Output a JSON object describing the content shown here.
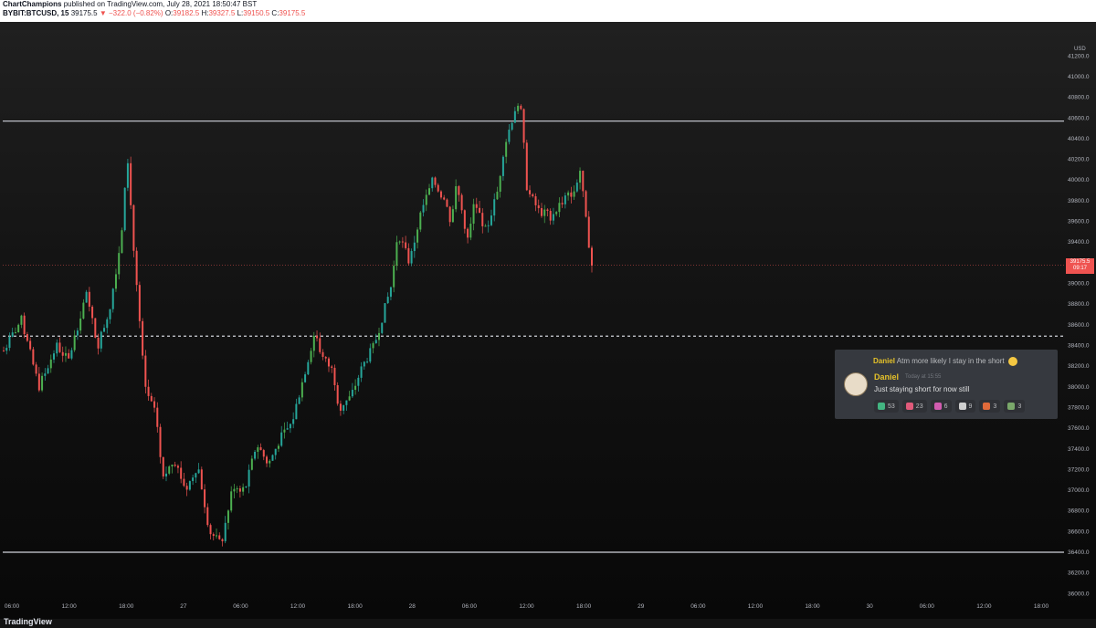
{
  "header": {
    "publisher": "ChartChampions",
    "publish_text": "published on TradingView.com, July 28, 2021 18:50:47 BST",
    "symbol": "BYBIT:BTCUSD, 15",
    "last": "39175.5",
    "change": "▼ −322.0 (−0.82%)",
    "o_label": "O:",
    "o": "39182.5",
    "h_label": "H:",
    "h": "39327.5",
    "l_label": "L:",
    "l": "39150.5",
    "c_label": "C:",
    "c": "39175.5"
  },
  "axis": {
    "currency": "USD",
    "price_tag_value": "39175.5",
    "price_tag_timer": "09:17"
  },
  "footer": {
    "brand": "TradingView"
  },
  "colors": {
    "up": "#26a69a",
    "up_bright": "#4caf50",
    "down": "#ef5350",
    "level_line": "#d1d4dc",
    "price_line": "#ef5350"
  },
  "discord": {
    "reply_name": "Daniel",
    "reply_text": "Atm more likely I stay in the short",
    "username": "Daniel",
    "timestamp": "Today at 15:55",
    "message": "Just staying short for now still",
    "reactions": [
      {
        "icon": "up-arrow-emoji",
        "count": "53",
        "color": "#43b581"
      },
      {
        "icon": "hammer-emoji",
        "count": "23",
        "color": "#e05a7a"
      },
      {
        "icon": "gift-emoji",
        "count": "6",
        "color": "#d15cb0"
      },
      {
        "icon": "goat-emoji",
        "count": "9",
        "color": "#cfcfcf"
      },
      {
        "icon": "rocket-emoji",
        "count": "3",
        "color": "#e06a3a"
      },
      {
        "icon": "bottle-emoji",
        "count": "3",
        "color": "#7aa86a"
      }
    ]
  },
  "chart_data": {
    "type": "candlestick",
    "symbol": "BYBIT:BTCUSD",
    "interval": "15",
    "y_ticks": [
      "41200.0",
      "41000.0",
      "40800.0",
      "40600.0",
      "40400.0",
      "40200.0",
      "40000.0",
      "39800.0",
      "39600.0",
      "39400.0",
      "39200.0",
      "39000.0",
      "38800.0",
      "38600.0",
      "38400.0",
      "38200.0",
      "38000.0",
      "37800.0",
      "37600.0",
      "37400.0",
      "37200.0",
      "37000.0",
      "36800.0",
      "36600.0",
      "36400.0",
      "36200.0",
      "36000.0"
    ],
    "x_ticks": [
      "06:00",
      "12:00",
      "18:00",
      "27",
      "06:00",
      "12:00",
      "18:00",
      "28",
      "06:00",
      "12:00",
      "18:00",
      "29",
      "06:00",
      "12:00",
      "18:00",
      "30",
      "06:00",
      "12:00",
      "18:00"
    ],
    "ylim": [
      35950,
      41450
    ],
    "grid": false,
    "key_levels": [
      {
        "price": 40570,
        "style": "solid"
      },
      {
        "price": 38490,
        "style": "dashed"
      },
      {
        "price": 36400,
        "style": "solid"
      }
    ],
    "last_price": 39175.5,
    "close_path": [
      [
        0,
        38350
      ],
      [
        3,
        38650
      ],
      [
        6,
        38000
      ],
      [
        9,
        38400
      ],
      [
        11,
        38250
      ],
      [
        14,
        38900
      ],
      [
        16,
        38400
      ],
      [
        18,
        38750
      ],
      [
        20,
        39450
      ],
      [
        21,
        40300
      ],
      [
        22,
        39400
      ],
      [
        24,
        38000
      ],
      [
        26,
        37700
      ],
      [
        27,
        37100
      ],
      [
        29,
        37300
      ],
      [
        31,
        37000
      ],
      [
        33,
        37250
      ],
      [
        35,
        36600
      ],
      [
        37,
        36480
      ],
      [
        39,
        37050
      ],
      [
        41,
        37000
      ],
      [
        43,
        37450
      ],
      [
        45,
        37250
      ],
      [
        47,
        37500
      ],
      [
        49,
        37650
      ],
      [
        51,
        38100
      ],
      [
        53,
        38550
      ],
      [
        54,
        38300
      ],
      [
        56,
        38150
      ],
      [
        57,
        37800
      ],
      [
        59,
        37900
      ],
      [
        61,
        38200
      ],
      [
        63,
        38400
      ],
      [
        64,
        38600
      ],
      [
        66,
        39000
      ],
      [
        67,
        39500
      ],
      [
        69,
        39200
      ],
      [
        71,
        39700
      ],
      [
        73,
        40000
      ],
      [
        75,
        39800
      ],
      [
        76,
        39600
      ],
      [
        77,
        39950
      ],
      [
        79,
        39400
      ],
      [
        80,
        39800
      ],
      [
        82,
        39500
      ],
      [
        84,
        39900
      ],
      [
        85,
        40300
      ],
      [
        87,
        40700
      ],
      [
        88,
        40650
      ],
      [
        89,
        39900
      ],
      [
        91,
        39700
      ],
      [
        93,
        39650
      ],
      [
        95,
        39800
      ],
      [
        97,
        39900
      ],
      [
        98,
        40100
      ],
      [
        99,
        39600
      ],
      [
        100,
        39175
      ]
    ]
  }
}
